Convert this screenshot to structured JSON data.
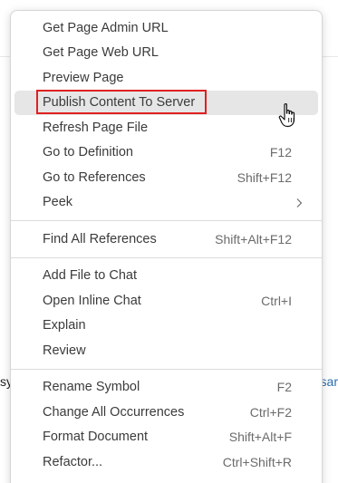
{
  "background": {
    "left_fragment": "sy",
    "right_fragment": "sar"
  },
  "menu": {
    "groups": [
      {
        "items": [
          {
            "label": "Get Page Admin URL",
            "shortcut": ""
          },
          {
            "label": "Get Page Web URL",
            "shortcut": ""
          },
          {
            "label": "Preview Page",
            "shortcut": ""
          },
          {
            "label": "Publish Content To Server",
            "shortcut": "",
            "hovered": true,
            "highlighted": true
          },
          {
            "label": "Refresh Page File",
            "shortcut": ""
          },
          {
            "label": "Go to Definition",
            "shortcut": "F12"
          },
          {
            "label": "Go to References",
            "shortcut": "Shift+F12"
          },
          {
            "label": "Peek",
            "shortcut": "",
            "submenu": true
          }
        ]
      },
      {
        "items": [
          {
            "label": "Find All References",
            "shortcut": "Shift+Alt+F12"
          }
        ]
      },
      {
        "items": [
          {
            "label": "Add File to Chat",
            "shortcut": ""
          },
          {
            "label": "Open Inline Chat",
            "shortcut": "Ctrl+I"
          },
          {
            "label": "Explain",
            "shortcut": ""
          },
          {
            "label": "Review",
            "shortcut": ""
          }
        ]
      },
      {
        "items": [
          {
            "label": "Rename Symbol",
            "shortcut": "F2"
          },
          {
            "label": "Change All Occurrences",
            "shortcut": "Ctrl+F2"
          },
          {
            "label": "Format Document",
            "shortcut": "Shift+Alt+F"
          },
          {
            "label": "Refactor...",
            "shortcut": "Ctrl+Shift+R"
          }
        ]
      }
    ]
  },
  "colors": {
    "highlight_border": "#e02020",
    "hover_background": "#e6e6e6",
    "text": "#3b3b3b",
    "shortcut_text": "#6b6b6b"
  },
  "icons": {
    "submenu": "chevron-right-icon",
    "cursor": "hand-pointer-cursor-icon"
  }
}
